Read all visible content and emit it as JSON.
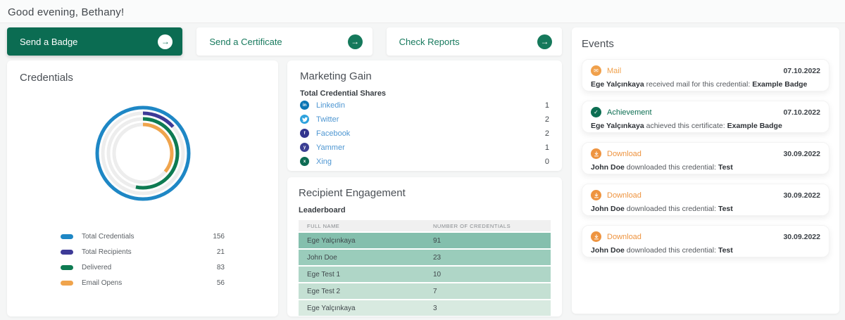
{
  "page": {
    "greeting": "Good evening, Bethany!"
  },
  "actions": [
    {
      "label": "Send a Badge"
    },
    {
      "label": "Send a Certificate"
    },
    {
      "label": "Check Reports"
    }
  ],
  "credentials": {
    "title": "Credentials",
    "chart_data": {
      "type": "concentric-donut",
      "max": 156,
      "track_color": "#ededed",
      "series": [
        {
          "name": "Total Credentials",
          "value": 156,
          "color": "#1e87c5"
        },
        {
          "name": "Total Recipients",
          "value": 21,
          "color": "#3d3a97"
        },
        {
          "name": "Delivered",
          "value": 83,
          "color": "#0e7b52"
        },
        {
          "name": "Email Opens",
          "value": 56,
          "color": "#f0a44c"
        }
      ]
    }
  },
  "marketing": {
    "title": "Marketing Gain",
    "subtitle": "Total Credential Shares",
    "rows": [
      {
        "network": "Linkedin",
        "value": 1,
        "color": "#0b76b5",
        "glyph": "in"
      },
      {
        "network": "Twitter",
        "value": 2,
        "color": "#2ea2dd",
        "glyph": ""
      },
      {
        "network": "Facebook",
        "value": 2,
        "color": "#32348e",
        "glyph": "f"
      },
      {
        "network": "Yammer",
        "value": 1,
        "color": "#3b3e93",
        "glyph": "y"
      },
      {
        "network": "Xing",
        "value": 0,
        "color": "#0d6b53",
        "glyph": "x"
      }
    ]
  },
  "engagement": {
    "title": "Recipient Engagement",
    "subtitle": "Leaderboard",
    "table": {
      "headers": [
        "FULL NAME",
        "NUMBER OF CREDENTIALS"
      ],
      "rows": [
        {
          "name": "Ege Yalçınkaya",
          "credentials": 91,
          "bg": "#84bfad"
        },
        {
          "name": "John Doe",
          "credentials": 23,
          "bg": "#9accbb"
        },
        {
          "name": "Ege Test 1",
          "credentials": 10,
          "bg": "#afd6c7"
        },
        {
          "name": "Ege Test 2",
          "credentials": 7,
          "bg": "#c4e0d3"
        },
        {
          "name": "Ege Yalçınkaya",
          "credentials": 3,
          "bg": "#d8eae0"
        }
      ]
    }
  },
  "events": {
    "title": "Events",
    "items": [
      {
        "type": "Mail",
        "date": "07.10.2022",
        "actor": "Ege Yalçınkaya",
        "action": "received mail for this credential:",
        "subject": "Example Badge",
        "accent": "#f0a04b"
      },
      {
        "type": "Achievement",
        "date": "07.10.2022",
        "actor": "Ege Yalçınkaya",
        "action": "achieved this certificate:",
        "subject": "Example Badge",
        "accent": "#0c6e52"
      },
      {
        "type": "Download",
        "date": "30.09.2022",
        "actor": "John Doe",
        "action": "downloaded this credential:",
        "subject": "Test",
        "accent": "#ee9440"
      },
      {
        "type": "Download",
        "date": "30.09.2022",
        "actor": "John Doe",
        "action": "downloaded this credential:",
        "subject": "Test",
        "accent": "#ee9440"
      },
      {
        "type": "Download",
        "date": "30.09.2022",
        "actor": "John Doe",
        "action": "downloaded this credential:",
        "subject": "Test",
        "accent": "#ee9440"
      }
    ]
  }
}
